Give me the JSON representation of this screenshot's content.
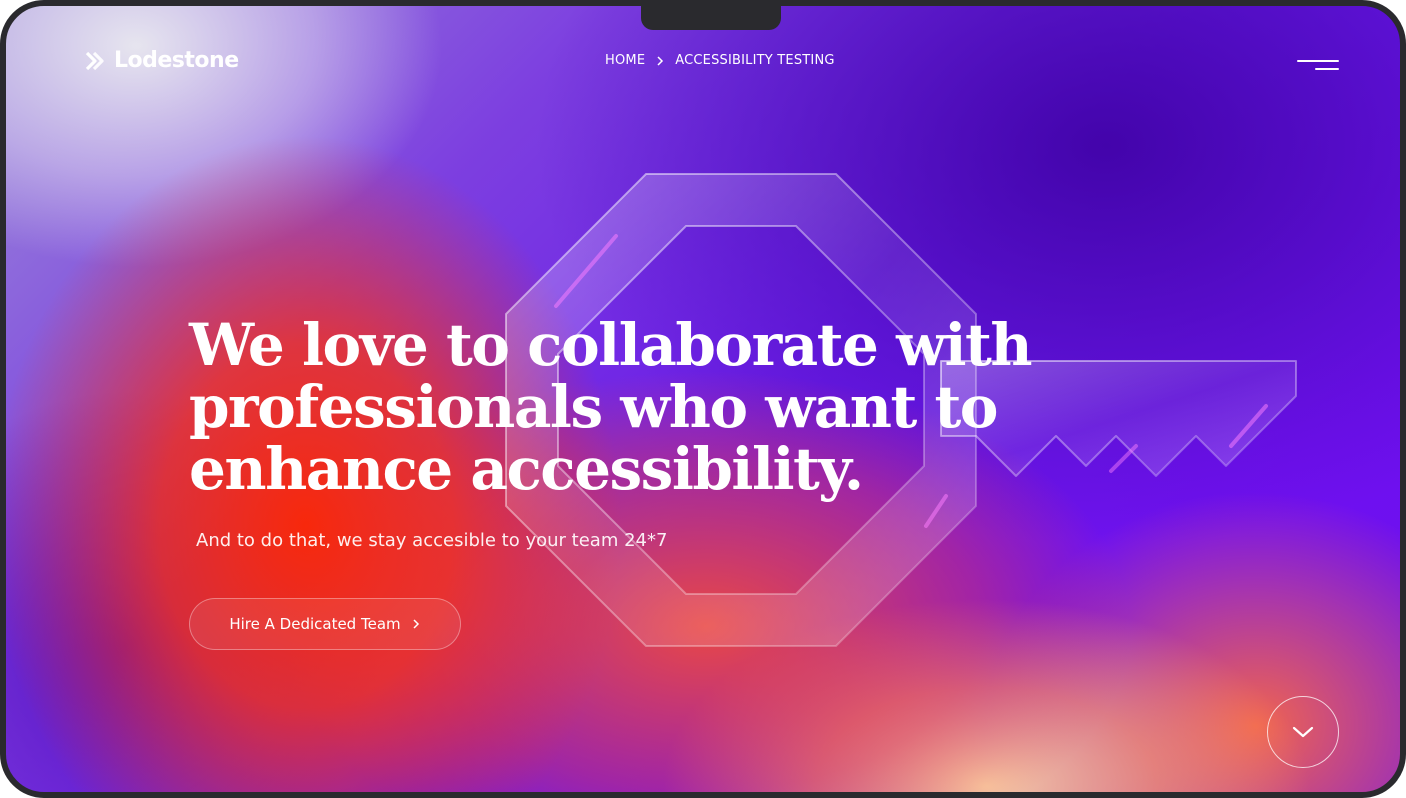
{
  "brand": {
    "name": "Lodestone",
    "logo_icon": "double-chevron-logo-icon"
  },
  "breadcrumb": {
    "items": [
      "HOME",
      "ACCESSIBILITY TESTING"
    ],
    "separator_icon": "chevron-right-icon"
  },
  "header": {
    "menu_icon": "hamburger-menu-icon"
  },
  "hero": {
    "headline_lines": [
      "We love to collaborate with",
      "professionals who want to",
      "enhance accessibility."
    ],
    "subline": "And to do that, we stay accesible to your team 24*7",
    "cta_label": "Hire A Dedicated Team",
    "cta_icon": "chevron-right-icon",
    "scroll_icon": "chevron-down-icon",
    "art_icon": "glass-key-icon"
  },
  "colors": {
    "primary_purple": "#6a10ee",
    "accent_orange": "#ff2a00",
    "text": "#ffffff",
    "frame": "#2a2a2e"
  }
}
